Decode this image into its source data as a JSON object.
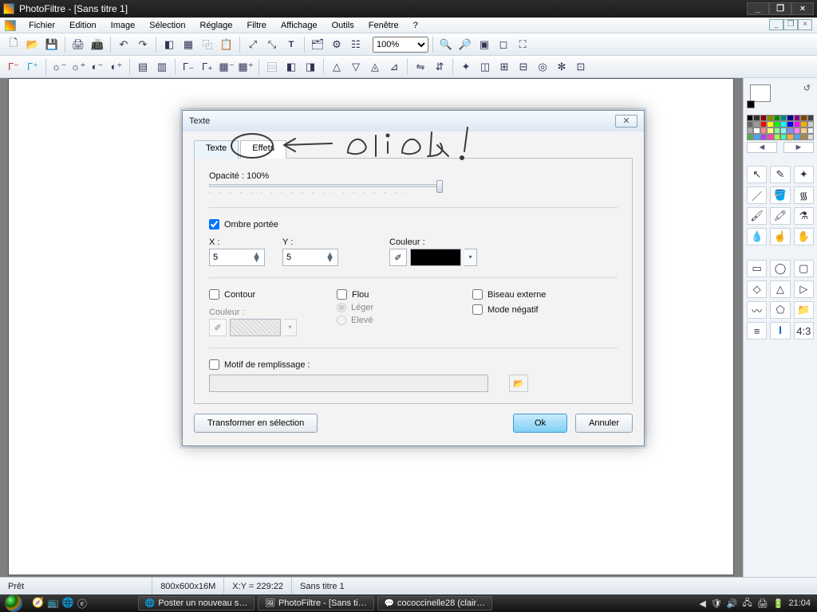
{
  "window": {
    "title": "PhotoFiltre - [Sans titre 1]"
  },
  "menus": [
    "Fichier",
    "Edition",
    "Image",
    "Sélection",
    "Réglage",
    "Filtre",
    "Affichage",
    "Outils",
    "Fenêtre",
    "?"
  ],
  "zoom": "100%",
  "status": {
    "ready": "Prêt",
    "dims": "800x600x16M",
    "coord": "X:Y = 229:22",
    "doc": "Sans titre 1"
  },
  "taskbar": {
    "items": [
      "Poster un nouveau s…",
      "PhotoFiltre - [Sans ti…",
      "cococcinelle28 (clair…"
    ],
    "clock": "21:04"
  },
  "dialog": {
    "title": "Texte",
    "tabs": {
      "texte": "Texte",
      "effets": "Effets"
    },
    "opacity_label": "Opacité : 100%",
    "shadow": {
      "label": "Ombre portée",
      "x_label": "X :",
      "x": "5",
      "y_label": "Y :",
      "y": "5",
      "color_label": "Couleur :"
    },
    "contour": {
      "label": "Contour",
      "color_label": "Couleur :"
    },
    "flou": {
      "label": "Flou",
      "leger": "Léger",
      "eleve": "Elevé"
    },
    "biseau": "Biseau externe",
    "negatif": "Mode négatif",
    "motif": "Motif de remplissage :",
    "transform": "Transformer en sélection",
    "ok": "Ok",
    "cancel": "Annuler"
  },
  "palette_colors": [
    "#000",
    "#333",
    "#800",
    "#880",
    "#080",
    "#088",
    "#008",
    "#808",
    "#840",
    "#444",
    "#666",
    "#999",
    "#f00",
    "#ff0",
    "#0f0",
    "#0ff",
    "#00f",
    "#f0f",
    "#fa0",
    "#ccc",
    "#aaa",
    "#fff",
    "#f88",
    "#ff8",
    "#8f8",
    "#8ff",
    "#88f",
    "#f8f",
    "#fc8",
    "#eee",
    "#5a5",
    "#4af",
    "#a4f",
    "#f4a",
    "#af4",
    "#4fa",
    "#fa4",
    "#4af",
    "#a84",
    "#ddd"
  ]
}
